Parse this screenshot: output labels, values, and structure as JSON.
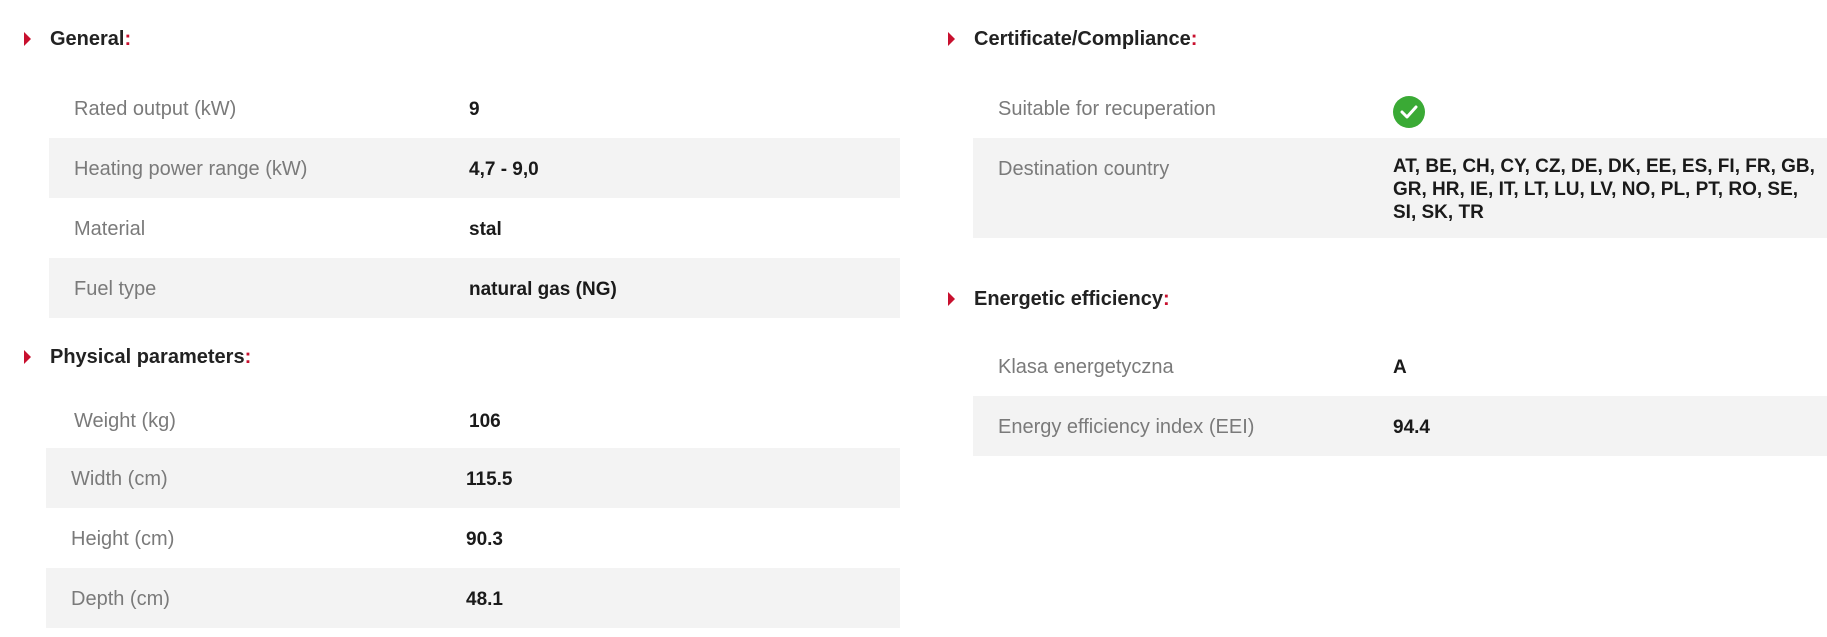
{
  "general": {
    "title": "General",
    "colon": ":",
    "rows": [
      {
        "label": "Rated output (kW)",
        "value": "9"
      },
      {
        "label": "Heating power range (kW)",
        "value": "4,7 - 9,0"
      },
      {
        "label": "Material",
        "value": "stal"
      },
      {
        "label": "Fuel type",
        "value": "natural gas (NG)"
      }
    ]
  },
  "physical": {
    "title": "Physical parameters",
    "colon": ":",
    "rows": [
      {
        "label": "Weight (kg)",
        "value": "106"
      },
      {
        "label": "Width (cm)",
        "value": "115.5"
      },
      {
        "label": "Height (cm)",
        "value": "90.3"
      },
      {
        "label": "Depth (cm)",
        "value": "48.1"
      }
    ]
  },
  "certificate": {
    "title": "Certificate/Compliance",
    "colon": ":",
    "rows": [
      {
        "label": "Suitable for recuperation",
        "icon": "check-circle-icon",
        "icon_color": "#3aaa35"
      },
      {
        "label": "Destination country",
        "value": "AT, BE, CH, CY, CZ, DE, DK, EE, ES, FI, FR, GB, GR, HR, IE, IT, LT, LU, LV, NO, PL, PT, RO, SE, SI, SK, TR"
      }
    ]
  },
  "energetic": {
    "title": "Energetic efficiency",
    "colon": ":",
    "rows": [
      {
        "label": "Klasa energetyczna",
        "value": "A"
      },
      {
        "label": "Energy efficiency index (EEI)",
        "value": "94.4"
      }
    ]
  },
  "colors": {
    "accent": "#c8102e",
    "row_shade": "#f3f3f3",
    "label_text": "#7a7a7a"
  }
}
